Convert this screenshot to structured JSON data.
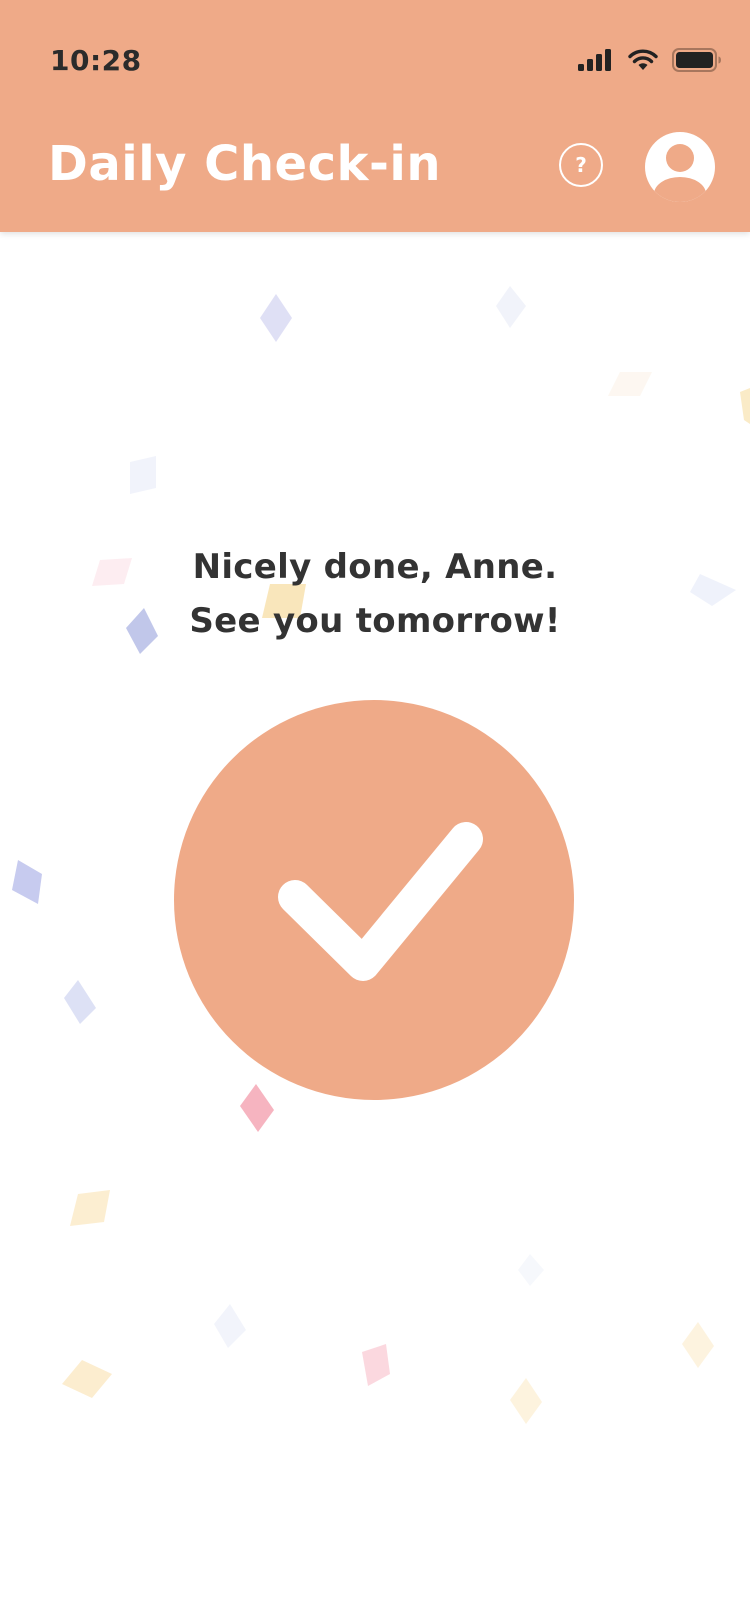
{
  "status_bar": {
    "time": "10:28",
    "signal_icon": "cellular-signal-icon",
    "wifi_icon": "wifi-icon",
    "battery_icon": "battery-icon"
  },
  "header": {
    "title": "Daily Check-in",
    "help_label": "?",
    "help_icon": "question-circle-icon",
    "avatar_icon": "user-avatar-icon"
  },
  "main": {
    "message_line1": "Nicely done, Anne.",
    "message_line2": "See you tomorrow!",
    "success_icon": "checkmark-icon"
  },
  "colors": {
    "accent": "#EFAA88",
    "text": "#333333",
    "background": "#FFFFFF"
  }
}
